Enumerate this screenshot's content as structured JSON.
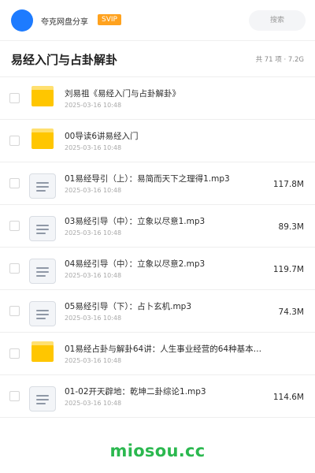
{
  "topbar": {
    "site_name": "夸克网盘分享",
    "badge": "SVIP",
    "search_placeholder": "搜索"
  },
  "header": {
    "title": "易经入门与占卦解卦",
    "summary": "共 71 项 · 7.2G"
  },
  "files": [
    {
      "type": "folder",
      "icon": "folder-icon",
      "name": "刘易祖《易经入门与占卦解卦》",
      "date": "2025-03-16 10:48",
      "size": ""
    },
    {
      "type": "folder",
      "icon": "folder-icon",
      "name": "00导读6讲易经入门",
      "date": "2025-03-16 10:48",
      "size": ""
    },
    {
      "type": "file",
      "icon": "document-icon",
      "name": "01易经导引（上）：易简而天下之理得1.mp3",
      "date": "2025-03-16 10:48",
      "size": "117.8M"
    },
    {
      "type": "file",
      "icon": "document-icon",
      "name": "03易经引导（中）：立象以尽意1.mp3",
      "date": "2025-03-16 10:48",
      "size": "89.3M"
    },
    {
      "type": "file",
      "icon": "document-icon",
      "name": "04易经引导（中）：立象以尽意2.mp3",
      "date": "2025-03-16 10:48",
      "size": "119.7M"
    },
    {
      "type": "file",
      "icon": "document-icon",
      "name": "05易经引导（下）：占卜玄机.mp3",
      "date": "2025-03-16 10:48",
      "size": "74.3M"
    },
    {
      "type": "folder",
      "icon": "folder-icon",
      "name": "01易经占卦与解卦64讲：人生事业经营的64种基本…",
      "date": "2025-03-16 10:48",
      "size": ""
    },
    {
      "type": "file",
      "icon": "document-icon",
      "name": "01-02开天辟地：乾坤二卦综论1.mp3",
      "date": "2025-03-16 10:48",
      "size": "114.6M"
    }
  ],
  "watermark": "miosou.cc",
  "colors": {
    "accent": "#1d7bff",
    "svip": "#ffa21e",
    "folder": "#ffc600",
    "watermark": "#2bb84f"
  }
}
